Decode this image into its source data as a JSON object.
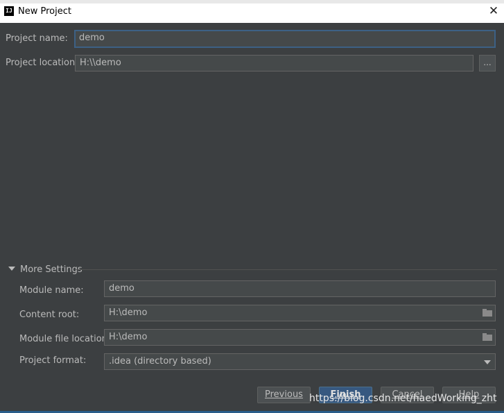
{
  "window": {
    "title": "New Project",
    "close_glyph": "✕",
    "app_icon": "IJ"
  },
  "project": {
    "name_label": "Project name:",
    "name_value": "demo",
    "location_label": "Project location:",
    "location_value": "H:\\\\demo",
    "browse_label": "..."
  },
  "more_settings": {
    "label": "More Settings",
    "module_name_label": "Module name:",
    "module_name_value": "demo",
    "content_root_label": "Content root:",
    "content_root_value": "H:\\demo",
    "module_file_label": "Module file location:",
    "module_file_value": "H:\\demo",
    "format_label": "Project format:",
    "format_value": ".idea (directory based)"
  },
  "buttons": {
    "previous": "Previous",
    "finish": "Finish",
    "cancel": "Cancel",
    "help": "Help"
  },
  "watermark": "https://blog.csdn.net/haedWorking_zht",
  "colors": {
    "background": "#3c3f41",
    "field": "#45494a",
    "focus_border": "#3d6185",
    "primary_button": "#365880"
  }
}
